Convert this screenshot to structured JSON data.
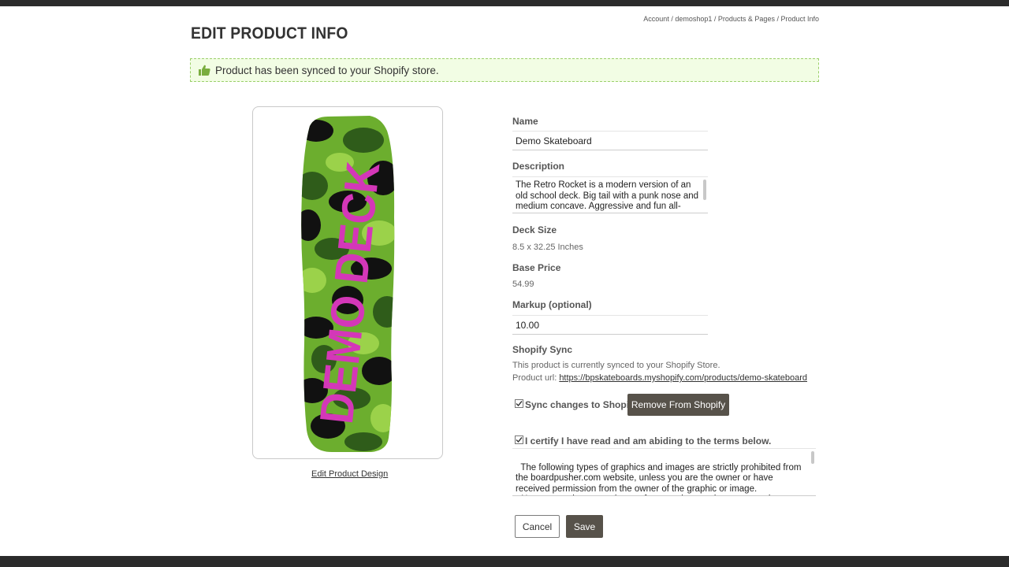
{
  "breadcrumb": {
    "items": [
      "Account",
      "demoshop1",
      "Products & Pages",
      "Product Info"
    ],
    "separator": " / "
  },
  "page_title": "EDIT PRODUCT INFO",
  "alert": {
    "icon": "thumbs-up-icon",
    "message": "Product has been synced to your Shopify store.",
    "color": "#7aad3f"
  },
  "preview": {
    "deck_text": "DEMO DECK",
    "edit_link": "Edit Product Design",
    "text_color": "#d437b8",
    "camo_colors": [
      "#2f5c1a",
      "#6cae2e",
      "#9bd24a",
      "#111111"
    ]
  },
  "form": {
    "name_label": "Name",
    "name_value": "Demo Skateboard",
    "description_label": "Description",
    "description_value": "The Retro Rocket is a modern version of an old school deck. Big tail with a punk nose and medium concave. Aggressive and fun all-around",
    "deck_size_label": "Deck Size",
    "deck_size_value": "8.5 x 32.25 Inches",
    "base_price_label": "Base Price",
    "base_price_value": "54.99",
    "markup_label": "Markup (optional)",
    "markup_value": "10.00",
    "shopify_sync_label": "Shopify Sync",
    "sync_status": "This product is currently synced to your Shopify Store.",
    "product_url_label": "Product url:",
    "product_url": "https://bpskateboards.myshopify.com/products/demo-skateboard",
    "sync_checkbox_label": "Sync changes to Shopify",
    "sync_checked": true,
    "remove_button": "Remove From Shopify",
    "certify_label": "I certify I have read and am abiding to the terms below.",
    "certify_checked": true,
    "terms_text": "The following types of graphics and images are strictly prohibited from the boardpusher.com website, unless you are the owner or have received permission from the owner of the graphic or image.\n- No names, pictures, or logos of companies, products, or pro skaters (i.e."
  },
  "actions": {
    "cancel": "Cancel",
    "save": "Save"
  }
}
